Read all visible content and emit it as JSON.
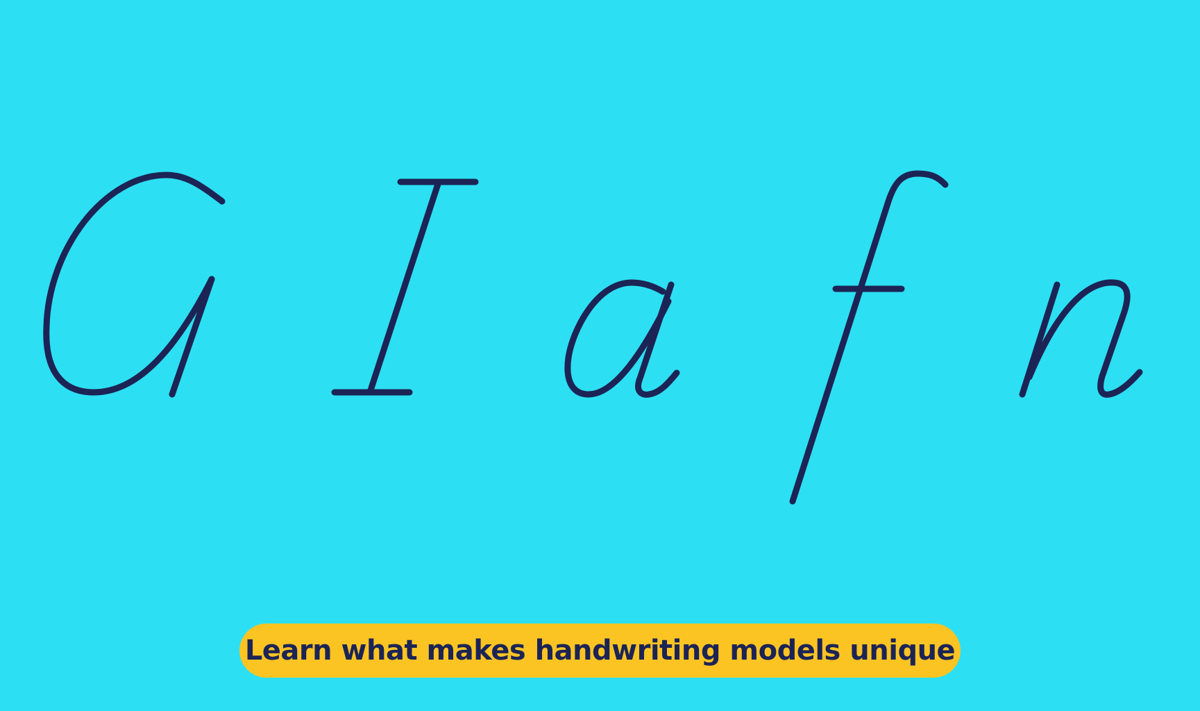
{
  "colors": {
    "background": "#2ddff3",
    "ink": "#1c2455",
    "button_bg": "#fbc423"
  },
  "letters": {
    "cap_g": "G",
    "cap_i": "I",
    "small_a": "a",
    "small_f": "f",
    "small_n": "n"
  },
  "cta": {
    "label": "Learn what makes handwriting models unique"
  }
}
